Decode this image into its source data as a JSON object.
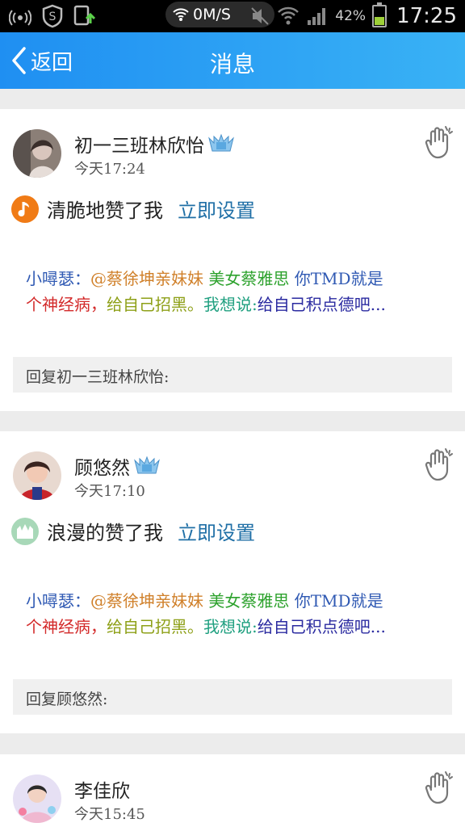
{
  "status_bar": {
    "speed": "0M/S",
    "battery_percent": "42%",
    "battery_level": 0.42,
    "time": "17:25"
  },
  "nav": {
    "back_label": "返回",
    "title": "消息"
  },
  "setting_link": "立即设置",
  "messages": [
    {
      "name": "初一三班林欣怡",
      "time": "今天17:24",
      "like_text": "清脆地赞了我",
      "like_icon": "music-note-icon",
      "like_icon_color": "#f07b16",
      "comment_line1": {
        "author": "小噚瑟：",
        "mention": "@蔡徐坤亲妹妹",
        "part2": "美女蔡雅思",
        "part3": "你TMD就是"
      },
      "comment_line2": {
        "part1": "个神经病，",
        "part2": "给自己招黑。",
        "part3": "我想说:",
        "part4": "给自己积点德吧..."
      },
      "reply_placeholder": "回复初一三班林欣怡:"
    },
    {
      "name": "顾悠然",
      "time": "今天17:10",
      "like_text": "浪漫的赞了我",
      "like_icon": "castle-icon",
      "like_icon_color": "#a8d8b8",
      "comment_line1": {
        "author": "小噚瑟：",
        "mention": "@蔡徐坤亲妹妹",
        "part2": "美女蔡雅思",
        "part3": "你TMD就是"
      },
      "comment_line2": {
        "part1": "个神经病，",
        "part2": "给自己招黑。",
        "part3": "我想说:",
        "part4": "给自己积点德吧..."
      },
      "reply_placeholder": "回复顾悠然:"
    },
    {
      "name": "李佳欣",
      "time": "今天15:45"
    }
  ]
}
